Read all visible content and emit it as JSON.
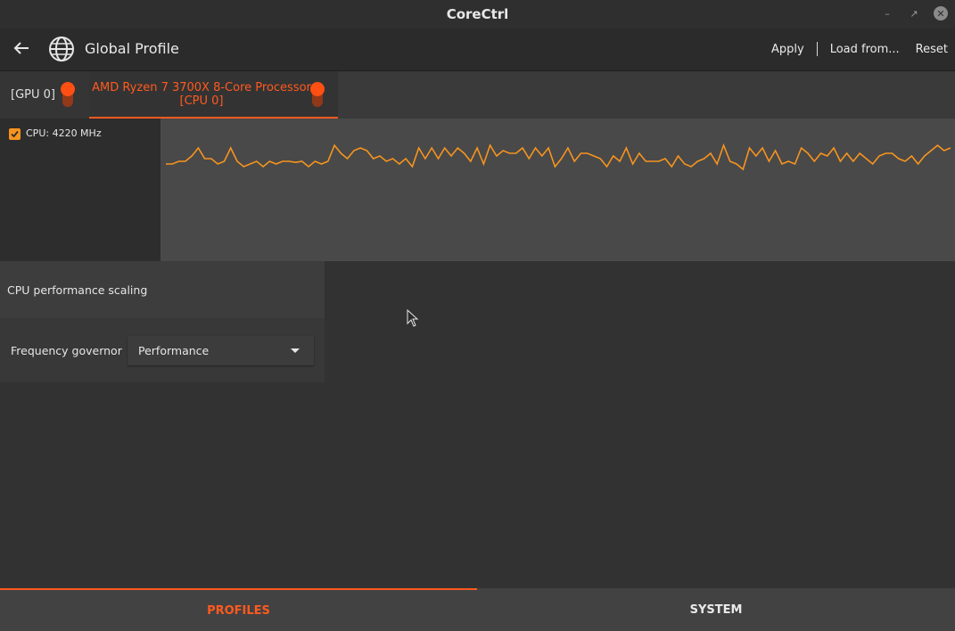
{
  "window": {
    "title": "CoreCtrl"
  },
  "header": {
    "title": "Global Profile",
    "actions": {
      "apply": "Apply",
      "load": "Load from...",
      "reset": "Reset"
    }
  },
  "tabs": [
    {
      "label": "[GPU 0]"
    },
    {
      "label_line1": "AMD Ryzen 7 3700X 8-Core Processor",
      "label_line2": "[CPU 0]"
    }
  ],
  "sensors": [
    {
      "label": "CPU: 4220 MHz",
      "checked": true,
      "color": "#f7941e"
    }
  ],
  "graph_series": {
    "color": "#f7941e",
    "values": [
      4195,
      4195,
      4200,
      4200,
      4210,
      4225,
      4205,
      4205,
      4195,
      4200,
      4225,
      4200,
      4190,
      4195,
      4200,
      4190,
      4200,
      4195,
      4200,
      4200,
      4198,
      4200,
      4190,
      4200,
      4195,
      4200,
      4230,
      4215,
      4205,
      4220,
      4225,
      4220,
      4205,
      4210,
      4200,
      4205,
      4195,
      4205,
      4190,
      4225,
      4205,
      4225,
      4205,
      4225,
      4210,
      4225,
      4215,
      4200,
      4225,
      4195,
      4230,
      4210,
      4220,
      4215,
      4215,
      4225,
      4205,
      4225,
      4210,
      4225,
      4190,
      4205,
      4225,
      4200,
      4215,
      4215,
      4210,
      4205,
      4190,
      4210,
      4200,
      4225,
      4195,
      4215,
      4200,
      4200,
      4200,
      4205,
      4190,
      4210,
      4195,
      4190,
      4200,
      4205,
      4215,
      4195,
      4230,
      4200,
      4195,
      4185,
      4225,
      4210,
      4225,
      4200,
      4220,
      4195,
      4200,
      4195,
      4225,
      4215,
      4200,
      4215,
      4210,
      4225,
      4200,
      4215,
      4200,
      4215,
      4205,
      4195,
      4210,
      4215,
      4215,
      4205,
      4200,
      4210,
      4195,
      4210,
      4220,
      4230,
      4220,
      4225
    ]
  },
  "panel": {
    "title": "CPU performance scaling",
    "governor_label": "Frequency governor",
    "governor_value": "Performance"
  },
  "bottom_tabs": {
    "profiles": "PROFILES",
    "system": "SYSTEM"
  },
  "colors": {
    "accent": "#ff5a1f",
    "series": "#f7941e"
  }
}
